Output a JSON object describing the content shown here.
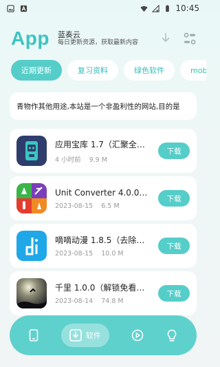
{
  "status": {
    "time": "10:45",
    "colors": {
      "text": "#333333"
    }
  },
  "header": {
    "logo": "App",
    "title": "蓝奏云",
    "subtitle": "每日更新资源，获取最新内容",
    "icons": [
      "download-icon",
      "settings-toggle-icon"
    ]
  },
  "tabs": [
    {
      "label": "近期更新",
      "active": true
    },
    {
      "label": "复习资料",
      "active": false
    },
    {
      "label": "绿色软件",
      "active": false
    },
    {
      "label": "mob游",
      "active": false
    }
  ],
  "notice": {
    "text": "青物作其他用途,本站是一个非盈利性的网站,目的是"
  },
  "items": [
    {
      "name": "应用宝库 1.7（汇聚全网...",
      "date": "4 小时前",
      "size": "9.9 M",
      "action": "下载",
      "icon": "robot-phone-icon"
    },
    {
      "name": "Unit Converter 4.0.0（免...",
      "date": "2023-08-15",
      "size": "6.5 M",
      "action": "下载",
      "icon": "unit-converter-icon"
    },
    {
      "name": "嘀嘀动漫 1.8.5（去除广告...",
      "date": "2023-08-15",
      "size": "10.0 M",
      "action": "下载",
      "icon": "di-logo-icon"
    },
    {
      "name": "千里 1.0.0（解锁免看广告...",
      "date": "2023-08-14",
      "size": "74.8 M",
      "action": "下载",
      "icon": "night-scene-icon"
    }
  ],
  "bottom_nav": {
    "items": [
      {
        "name": "phone",
        "icon": "phone-icon"
      },
      {
        "name": "software",
        "label": "软件",
        "icon": "download-box-icon",
        "active": true
      },
      {
        "name": "video",
        "icon": "play-icon"
      },
      {
        "name": "idea",
        "icon": "bulb-icon"
      }
    ]
  },
  "colors": {
    "accent": "#55cdc9",
    "logo": "#3cc4c0",
    "nav_bg": "#5fd1cd"
  }
}
